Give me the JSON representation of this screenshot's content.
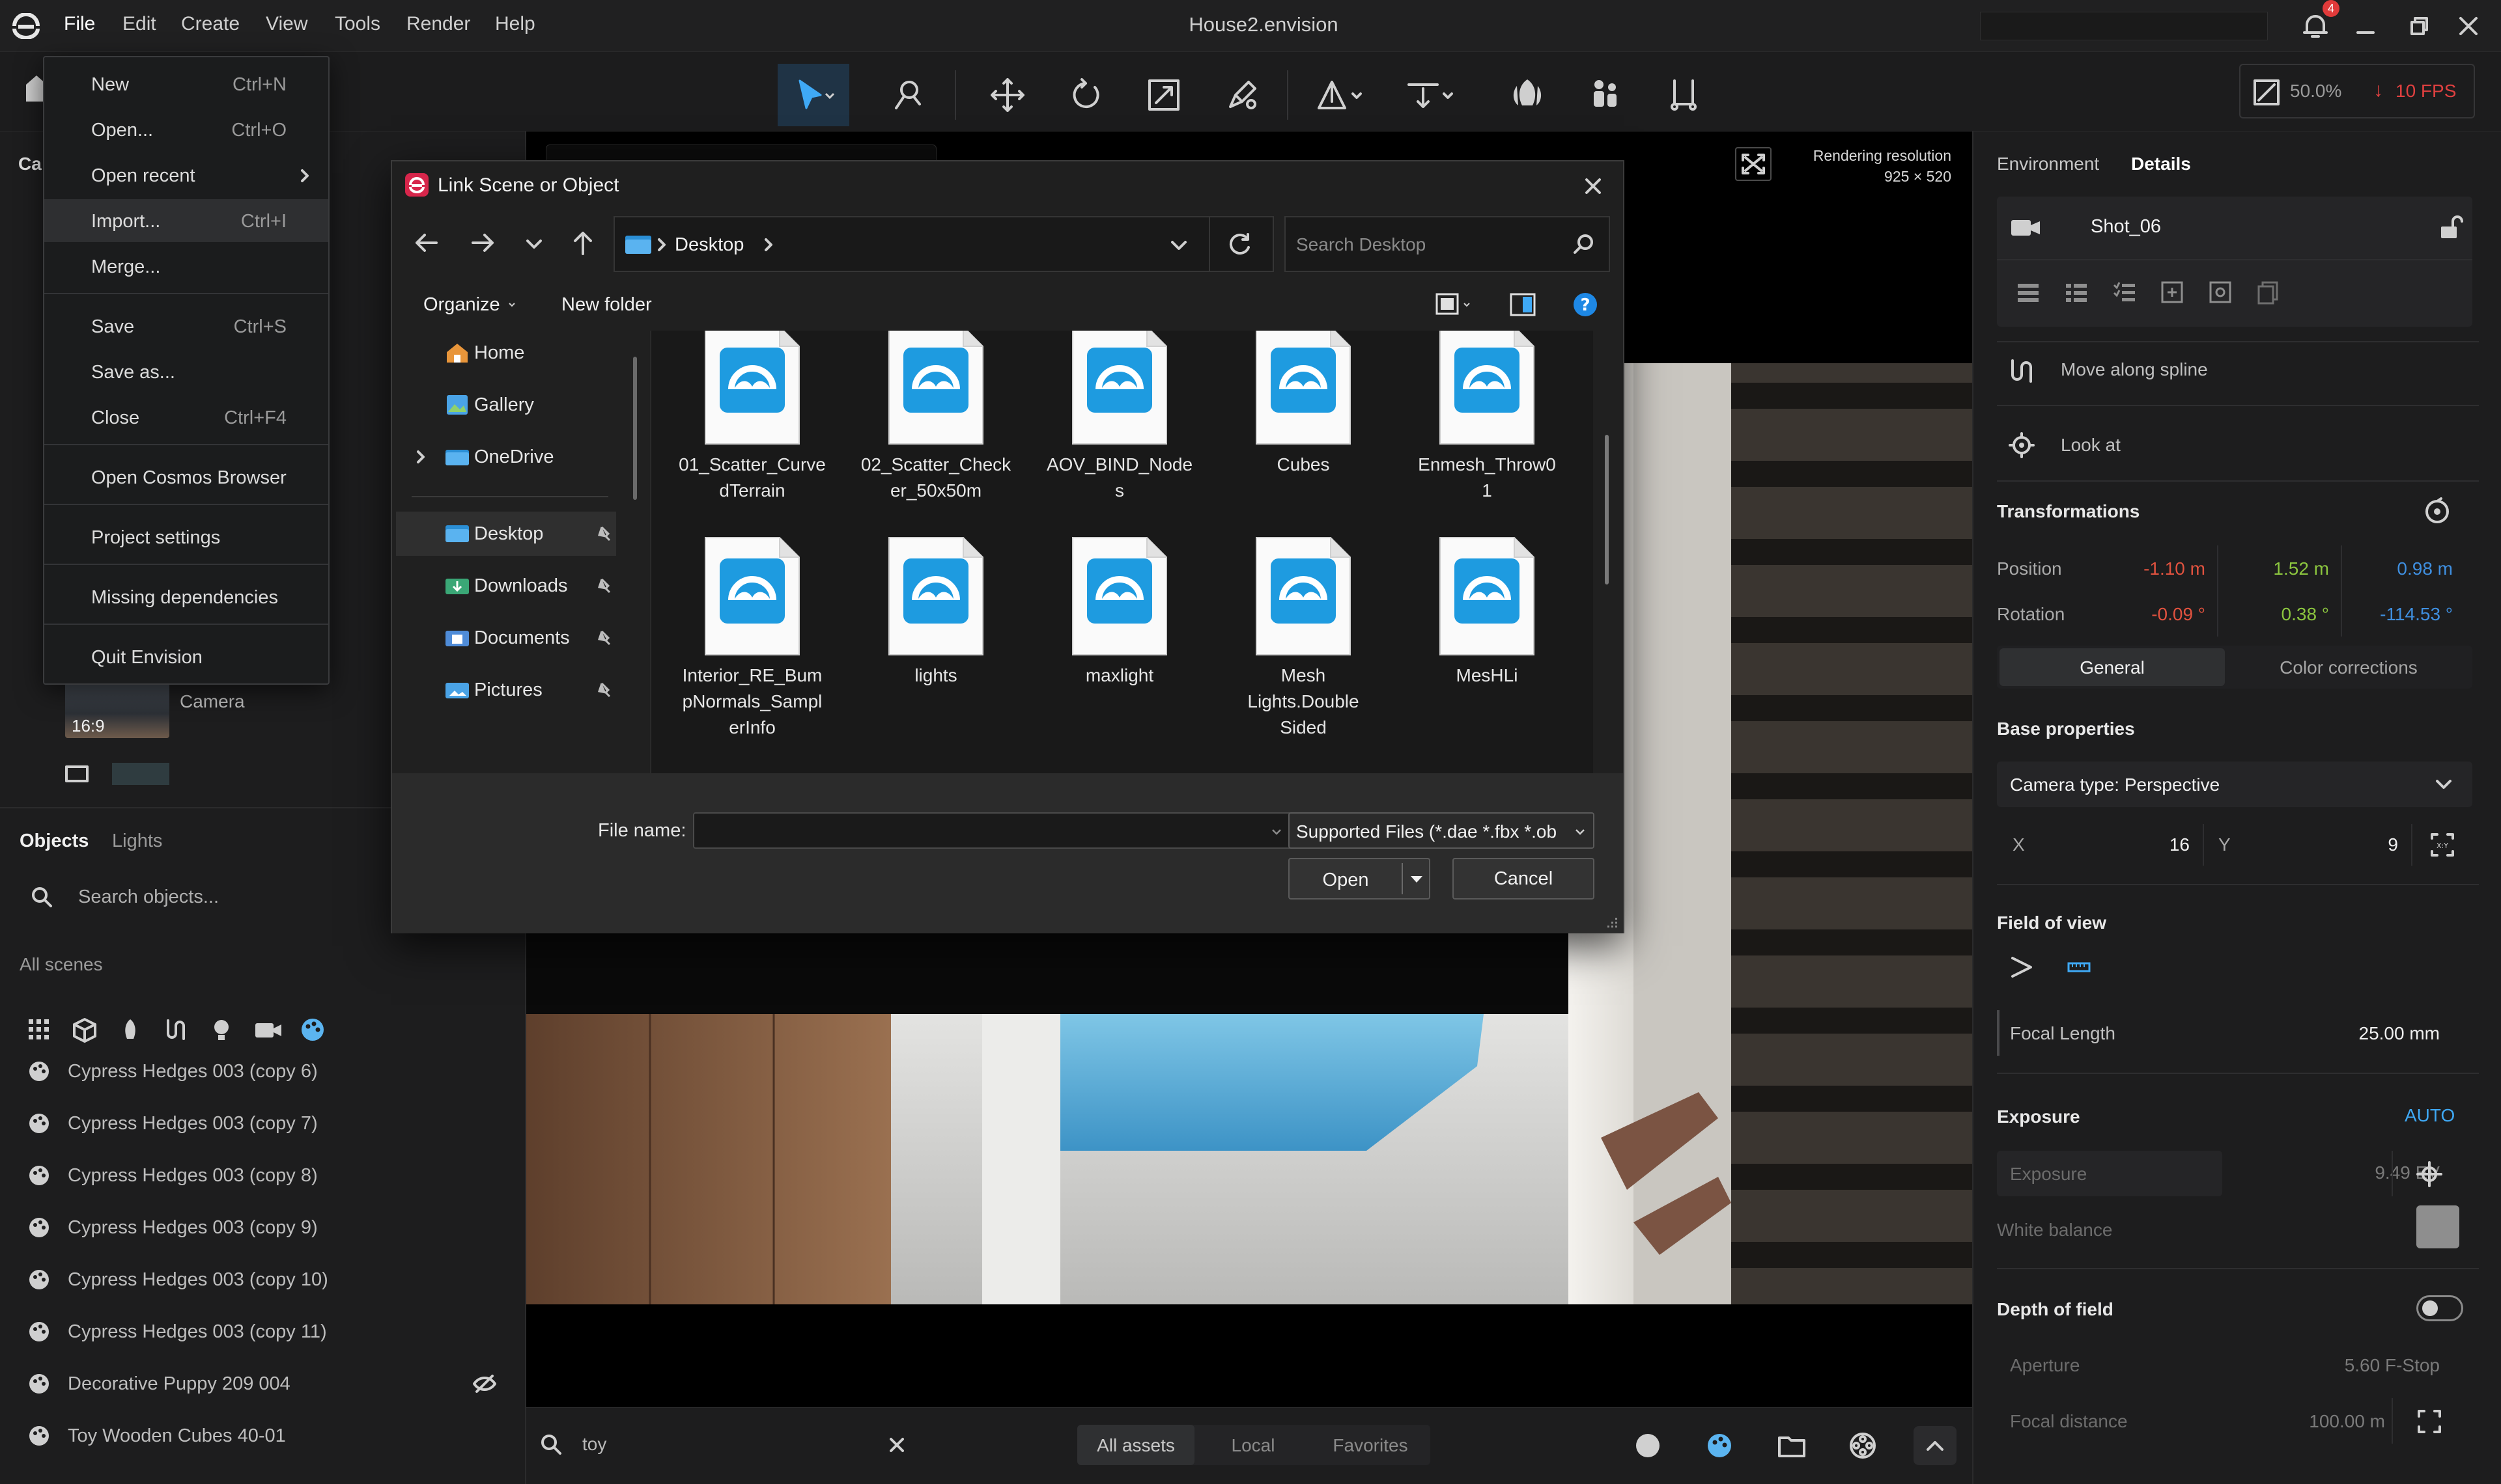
{
  "app": {
    "title": "House2.envision",
    "menu": [
      "File",
      "Edit",
      "Create",
      "View",
      "Tools",
      "Render",
      "Help"
    ],
    "notification_count": "4",
    "zoom": "50.0%",
    "fps": "10 FPS"
  },
  "file_menu": {
    "items": [
      {
        "label": "New",
        "shortcut": "Ctrl+N"
      },
      {
        "label": "Open...",
        "shortcut": "Ctrl+O"
      },
      {
        "label": "Open recent",
        "shortcut": ""
      },
      {
        "label": "Import...",
        "shortcut": "Ctrl+I"
      },
      {
        "label": "Merge...",
        "shortcut": ""
      },
      {
        "label": "Save",
        "shortcut": "Ctrl+S"
      },
      {
        "label": "Save as...",
        "shortcut": ""
      },
      {
        "label": "Close",
        "shortcut": "Ctrl+F4"
      },
      {
        "label": "Open Cosmos Browser",
        "shortcut": ""
      },
      {
        "label": "Project settings",
        "shortcut": ""
      },
      {
        "label": "Missing dependencies",
        "shortcut": ""
      },
      {
        "label": "Quit Envision",
        "shortcut": ""
      }
    ]
  },
  "left_panel": {
    "camera_label": "Camera",
    "aspect": "16:9",
    "tabs": [
      "Objects",
      "Lights"
    ],
    "search_placeholder": "Search objects...",
    "scenes_label": "All scenes",
    "objects": [
      "Cypress Hedges 003 (copy 6)",
      "Cypress Hedges 003 (copy 7)",
      "Cypress Hedges 003 (copy 8)",
      "Cypress Hedges 003 (copy 9)",
      "Cypress Hedges 003 (copy 10)",
      "Cypress Hedges 003 (copy 11)",
      "Decorative Puppy 209 004",
      "Toy Wooden Cubes 40-01"
    ]
  },
  "viewport": {
    "render_res_label": "Rendering resolution",
    "render_res_value": "925 × 520"
  },
  "bottom_bar": {
    "search_value": "toy",
    "tabs": [
      "All assets",
      "Local",
      "Favorites"
    ]
  },
  "right_panel": {
    "tabs": [
      "Environment",
      "Details"
    ],
    "shot_name": "Shot_06",
    "move_along_spline": "Move along spline",
    "look_at": "Look at",
    "transformations": "Transformations",
    "position_label": "Position",
    "position": [
      "-1.10 m",
      "1.52 m",
      "0.98 m"
    ],
    "rotation_label": "Rotation",
    "rotation": [
      "-0.09 °",
      "0.38 °",
      "-114.53 °"
    ],
    "subtabs": [
      "General",
      "Color corrections"
    ],
    "base_properties": "Base properties",
    "camera_type": "Camera type: Perspective",
    "x_label": "X",
    "x_value": "16",
    "y_label": "Y",
    "y_value": "9",
    "fov": "Field of view",
    "focal_length_label": "Focal Length",
    "focal_length_value": "25.00 mm",
    "exposure_head": "Exposure",
    "exposure_auto": "AUTO",
    "exposure_label": "Exposure",
    "exposure_value": "9.49 EV",
    "white_balance": "White balance",
    "dof": "Depth of field",
    "aperture_label": "Aperture",
    "aperture_value": "5.60 F-Stop",
    "focal_distance_label": "Focal distance",
    "focal_distance_value": "100.00 m",
    "colors": {
      "x": "#e0523f",
      "y": "#8cc63f",
      "z": "#3f8fe0"
    }
  },
  "dialog": {
    "title": "Link Scene or Object",
    "breadcrumb": "Desktop",
    "search_placeholder": "Search Desktop",
    "organize": "Organize",
    "new_folder": "New folder",
    "nav": [
      {
        "label": "Home",
        "pinned": false
      },
      {
        "label": "Gallery",
        "pinned": false
      },
      {
        "label": "OneDrive",
        "pinned": false
      },
      {
        "label": "Desktop",
        "pinned": true
      },
      {
        "label": "Downloads",
        "pinned": true
      },
      {
        "label": "Documents",
        "pinned": true
      },
      {
        "label": "Pictures",
        "pinned": true
      }
    ],
    "files": [
      [
        "01_Scatter_Curve",
        "dTerrain"
      ],
      [
        "02_Scatter_Check",
        "er_50x50m"
      ],
      [
        "AOV_BIND_Node",
        "s"
      ],
      [
        "Cubes"
      ],
      [
        "Enmesh_Throw0",
        "1"
      ],
      [
        "Interior_RE_Bum",
        "pNormals_Sampl",
        "erInfo"
      ],
      [
        "lights"
      ],
      [
        "maxlight"
      ],
      [
        "Mesh",
        "Lights.Double",
        "Sided"
      ],
      [
        "MesHLi"
      ]
    ],
    "file_name_label": "File name:",
    "file_name_value": "",
    "file_type": "Supported Files (*.dae *.fbx *.ob",
    "open": "Open",
    "cancel": "Cancel"
  }
}
